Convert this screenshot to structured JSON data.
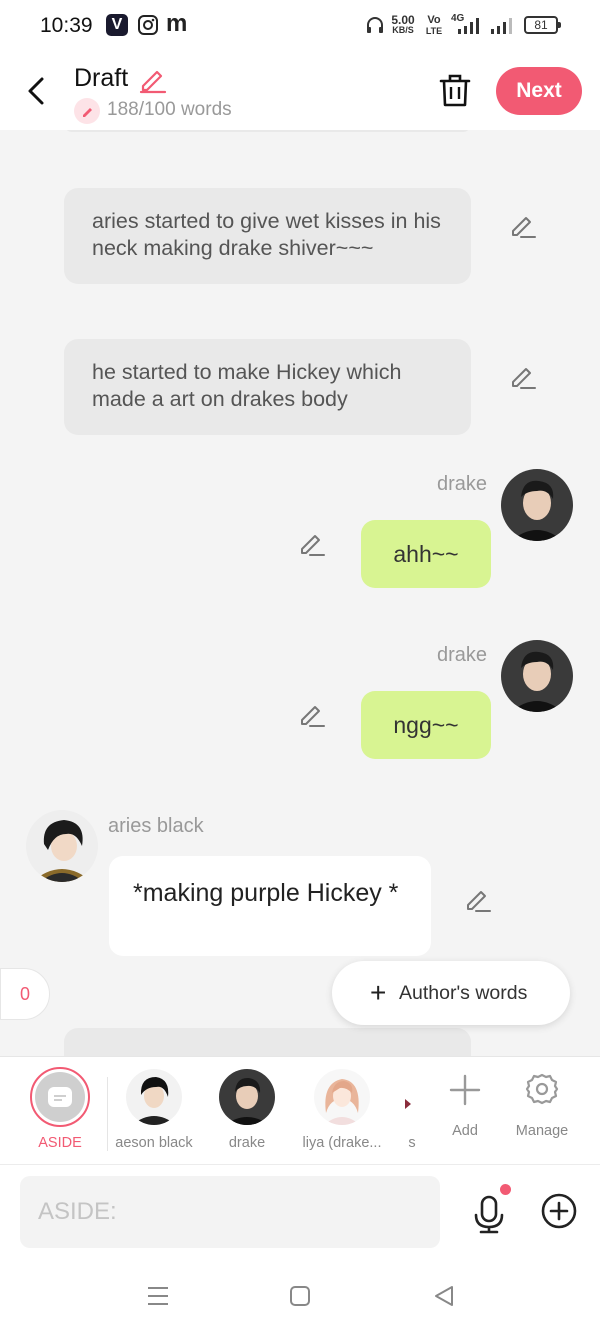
{
  "status_bar": {
    "time": "10:39",
    "net_speed": "5.00",
    "net_unit": "KB/S",
    "volte": "Vo",
    "lte": "LTE",
    "network": "4G",
    "battery": "81"
  },
  "header": {
    "title": "Draft",
    "word_count": "188/100 words",
    "next_label": "Next"
  },
  "messages": [
    {
      "type": "narration",
      "text": "aries started to give wet kisses in his neck making drake shiver~~~"
    },
    {
      "type": "narration",
      "text": "he started to make Hickey which made a art on drakes body"
    },
    {
      "type": "right",
      "name": "drake",
      "text": "ahh~~"
    },
    {
      "type": "right",
      "name": "drake",
      "text": "ngg~~"
    },
    {
      "type": "left",
      "name": "aries black",
      "text": "*making purple Hickey *"
    }
  ],
  "side_count": "0",
  "authors_words_label": "Author's words",
  "characters": [
    {
      "label": "ASIDE",
      "selected": true
    },
    {
      "label": "aeson black"
    },
    {
      "label": "drake"
    },
    {
      "label": "liya (drake..."
    },
    {
      "label": "s"
    }
  ],
  "actions": {
    "add_label": "Add",
    "manage_label": "Manage"
  },
  "input": {
    "placeholder": "ASIDE:"
  },
  "colors": {
    "accent": "#f25a73",
    "bubble_green": "#d8f492",
    "narration_bg": "#e9e9e9"
  }
}
